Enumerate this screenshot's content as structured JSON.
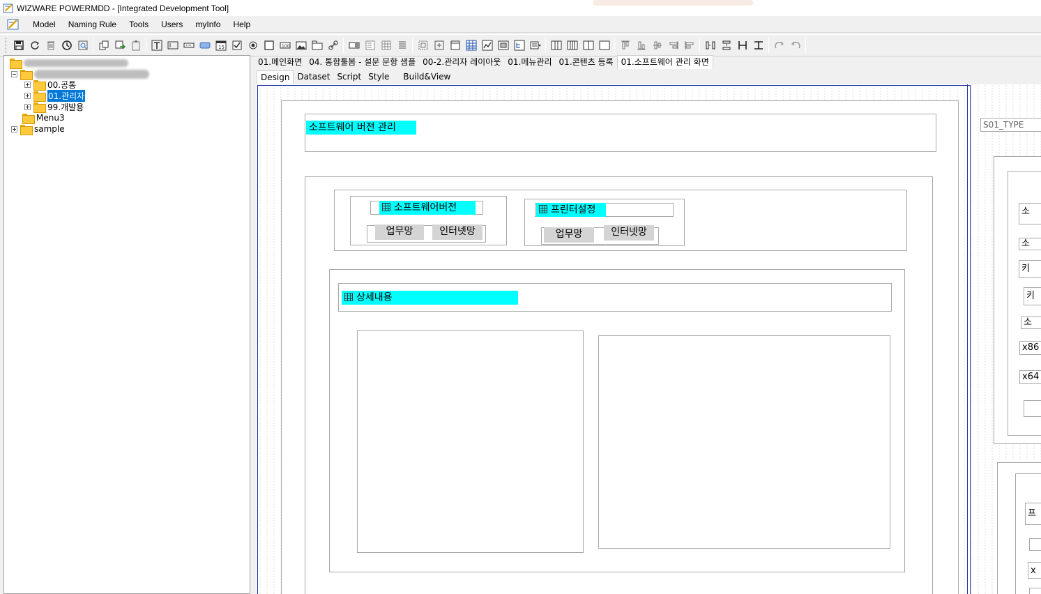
{
  "window": {
    "title": "WIZWARE POWERMDD - [Integrated Development Tool]"
  },
  "menu": {
    "items": [
      "Model",
      "Naming Rule",
      "Tools",
      "Users",
      "myInfo",
      "Help"
    ]
  },
  "tree": {
    "nodes": [
      {
        "label": "00.공통"
      },
      {
        "label": "01.관리자",
        "selected": true
      },
      {
        "label": "99.개발용"
      },
      {
        "label": "Menu3"
      },
      {
        "label": "sample"
      }
    ]
  },
  "doc_tabs": [
    "01.메인화면",
    "04. 통합툴봄 - 설문 문항 샘플",
    "00-2.관리자 레이아웃",
    "01.메뉴관리",
    "01.콘텐츠 등록",
    "01.소프트웨어 관리 화면"
  ],
  "active_doc_tab": "01.소프트웨어 관리 화면",
  "sub_tabs": [
    "Design",
    "Dataset",
    "Script",
    "Style",
    "Build&View"
  ],
  "form": {
    "title_label": "소프트웨어 버전 관리",
    "panel_software": {
      "label": "소프트웨어버전",
      "btn_work": "업무망",
      "btn_internet": "인터넷망"
    },
    "panel_printer": {
      "label": "프린터설정",
      "btn_work": "업무망",
      "btn_internet": "인터넷망"
    },
    "detail_label": "상세내용",
    "right_field": "S01_TYPE",
    "right_clipped": [
      "소",
      "소",
      "키",
      "키",
      "소",
      "x86",
      "x64",
      "프",
      "x"
    ]
  },
  "colors": {
    "label_bg": "#00ffff",
    "form_border": "#1a2ea8",
    "selection": "#0078d7"
  }
}
